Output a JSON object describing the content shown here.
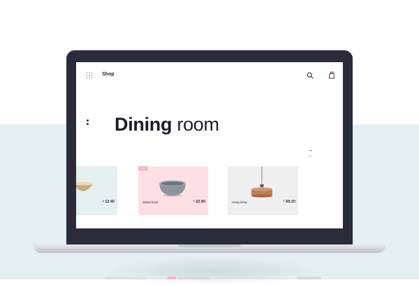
{
  "header": {
    "title": "Shop",
    "menu_icon": "grid-icon",
    "search_icon": "search-icon",
    "bag_icon": "shopping-bag-icon"
  },
  "hero": {
    "title_bold": "Dining",
    "title_light": "room",
    "next_arrow": "→"
  },
  "products": [
    {
      "name": "",
      "price_currency": "$",
      "price": "12.40",
      "background": "#e3eff0"
    },
    {
      "name": "Salad bowl",
      "price_currency": "$",
      "price": "22.90",
      "badge": "NEW",
      "background": "#fde0e3"
    },
    {
      "name": "Hang lamp",
      "price_currency": "$",
      "price": "69.20",
      "background": "#efefef"
    }
  ],
  "colors": {
    "accent_pink": "#f2aab5",
    "text_dark": "#1c1c2b",
    "page_band": "#e3eff0",
    "laptop_frame": "#2a2c39"
  }
}
